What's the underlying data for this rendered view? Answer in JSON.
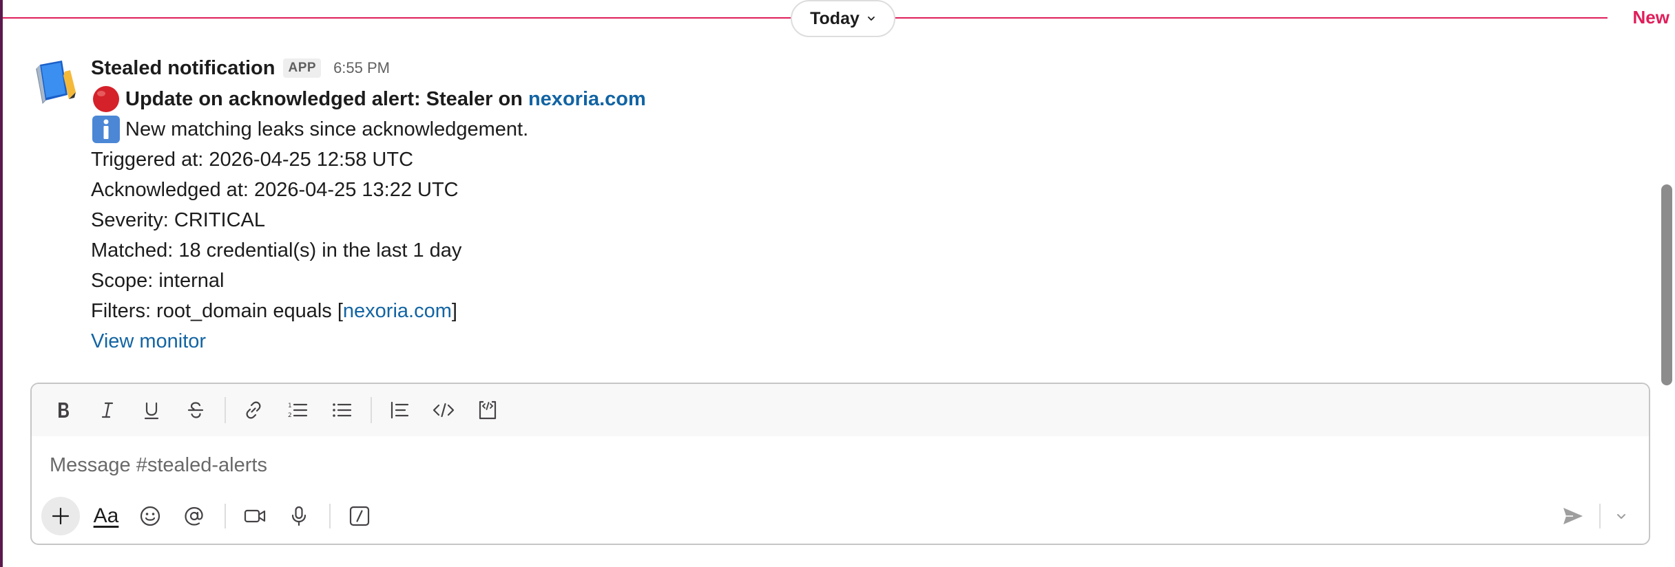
{
  "divider": {
    "label": "Today",
    "new_label": "New"
  },
  "message": {
    "sender": "Stealed notification",
    "badge": "APP",
    "time": "6:55 PM",
    "title_prefix": "Update on acknowledged alert: Stealer on ",
    "title_link": "nexoria.com",
    "info": "New matching leaks since acknowledgement.",
    "triggered": "Triggered at: 2026-04-25 12:58 UTC",
    "acknowledged": "Acknowledged at: 2026-04-25 13:22 UTC",
    "severity": "Severity: CRITICAL",
    "matched": "Matched: 18 credential(s) in the last 1 day",
    "scope": "Scope: internal",
    "filters_prefix": "Filters: root_domain equals [",
    "filters_link": "nexoria.com",
    "filters_suffix": "]",
    "view_link": "View monitor"
  },
  "composer": {
    "placeholder": "Message #stealed-alerts",
    "format_text_label": "Aa"
  },
  "icons": {
    "avatar": "blue-book-icon",
    "alert": "red-circle-icon",
    "info": "information-icon"
  },
  "colors": {
    "accent": "#e01e5a",
    "link": "#1264a3",
    "sidebar": "#5b1a4d"
  }
}
